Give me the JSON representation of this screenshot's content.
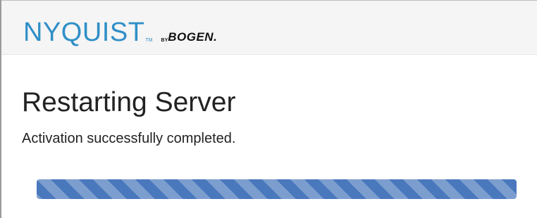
{
  "brand": {
    "primary": "NYQUIST",
    "trademark": "TM",
    "by": "BY",
    "secondary": "BOGEN."
  },
  "main": {
    "title": "Restarting Server",
    "message": "Activation successfully completed."
  },
  "progress": {
    "fraction": 1.0,
    "style": "striped",
    "color": "#4a78bd"
  },
  "colors": {
    "brand": "#2f8fc7",
    "header_bg": "#f5f5f5",
    "text": "#222222"
  }
}
